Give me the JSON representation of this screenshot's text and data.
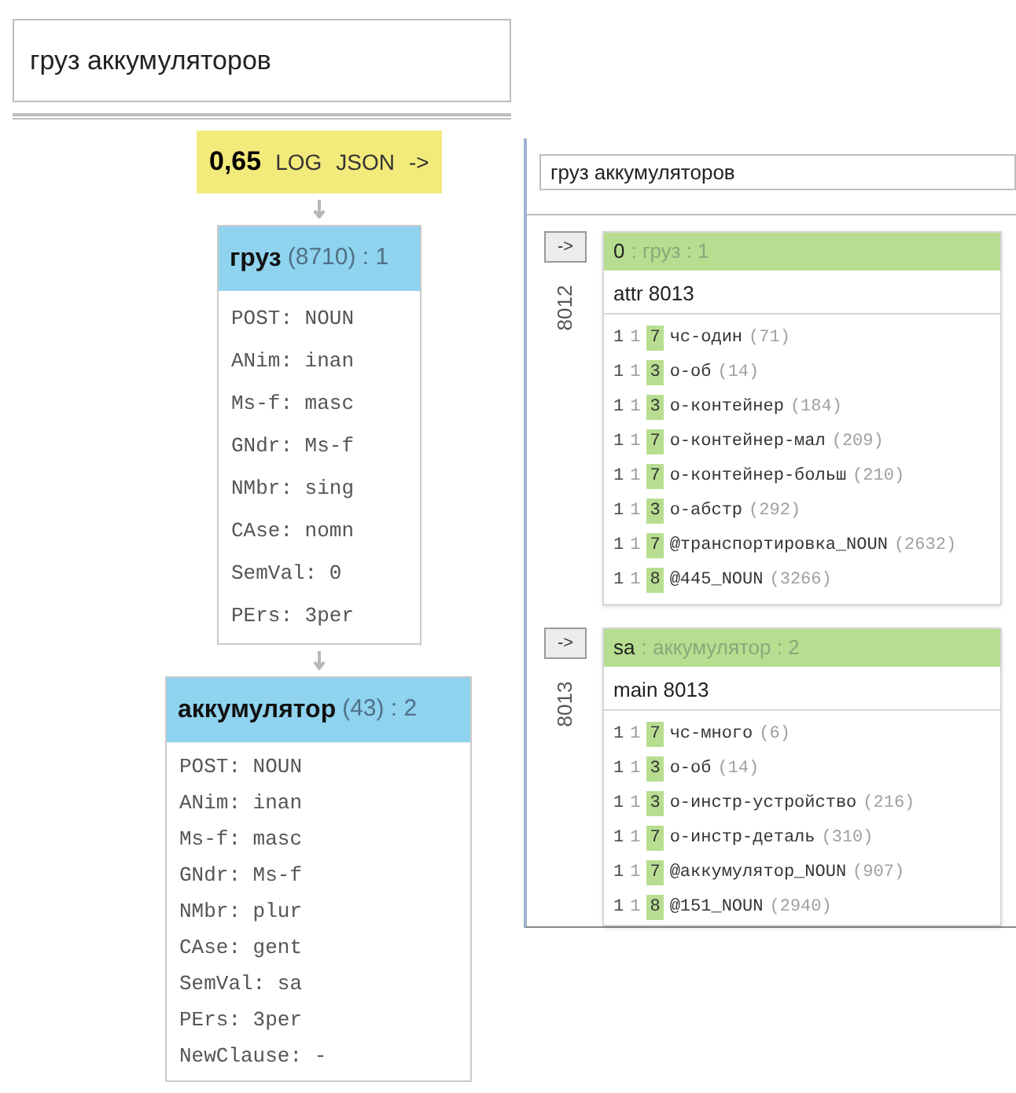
{
  "left_panel": {
    "query": {
      "value": "груз аккумуляторов"
    },
    "result": {
      "score": "0,65",
      "links": [
        "LOG",
        "JSON",
        "->"
      ]
    },
    "nodes": [
      {
        "word": "груз",
        "meta": "(8710) : 1",
        "features": [
          "POST: NOUN",
          "ANim: inan",
          "Ms-f: masc",
          "GNdr: Ms-f",
          "NMbr: sing",
          "CAse: nomn",
          "SemVal: 0",
          "PErs: 3per"
        ]
      },
      {
        "word": "аккумулятор",
        "meta": "(43) : 2",
        "features": [
          "POST: NOUN",
          "ANim: inan",
          "Ms-f: masc",
          "GNdr: Ms-f",
          "NMbr: plur",
          "CAse: gent",
          "SemVal: sa",
          "PErs: 3per",
          "NewClause: -"
        ]
      }
    ]
  },
  "right_panel": {
    "query": {
      "value": "груз аккумуляторов"
    },
    "groups": [
      {
        "button": "->",
        "id": "8012",
        "role": "0",
        "title": ": груз : 1",
        "subtitle": "attr 8013",
        "rows": [
          {
            "col_1": "1",
            "col_2": "1",
            "weight": "7",
            "name": "чс-один",
            "count": "(71)"
          },
          {
            "col_1": "1",
            "col_2": "1",
            "weight": "3",
            "name": "о-об",
            "count": "(14)"
          },
          {
            "col_1": "1",
            "col_2": "1",
            "weight": "3",
            "name": "о-контейнер",
            "count": "(184)"
          },
          {
            "col_1": "1",
            "col_2": "1",
            "weight": "7",
            "name": "о-контейнер-мал",
            "count": "(209)"
          },
          {
            "col_1": "1",
            "col_2": "1",
            "weight": "7",
            "name": "о-контейнер-больш",
            "count": "(210)"
          },
          {
            "col_1": "1",
            "col_2": "1",
            "weight": "3",
            "name": "о-абстр",
            "count": "(292)"
          },
          {
            "col_1": "1",
            "col_2": "1",
            "weight": "7",
            "name": "@транспортировка_NOUN",
            "count": "(2632)"
          },
          {
            "col_1": "1",
            "col_2": "1",
            "weight": "8",
            "name": "@445_NOUN",
            "count": "(3266)"
          }
        ]
      },
      {
        "button": "->",
        "id": "8013",
        "role": "sa",
        "title": ": аккумулятор : 2",
        "subtitle": "main 8013",
        "rows": [
          {
            "col_1": "1",
            "col_2": "1",
            "weight": "7",
            "name": "чс-много",
            "count": "(6)"
          },
          {
            "col_1": "1",
            "col_2": "1",
            "weight": "3",
            "name": "о-об",
            "count": "(14)"
          },
          {
            "col_1": "1",
            "col_2": "1",
            "weight": "3",
            "name": "о-инстр-устройство",
            "count": "(216)"
          },
          {
            "col_1": "1",
            "col_2": "1",
            "weight": "7",
            "name": "о-инстр-деталь",
            "count": "(310)"
          },
          {
            "col_1": "1",
            "col_2": "1",
            "weight": "7",
            "name": "@аккумулятор_NOUN",
            "count": "(907)"
          },
          {
            "col_1": "1",
            "col_2": "1",
            "weight": "8",
            "name": "@151_NOUN",
            "count": "(2940)"
          }
        ]
      }
    ]
  }
}
